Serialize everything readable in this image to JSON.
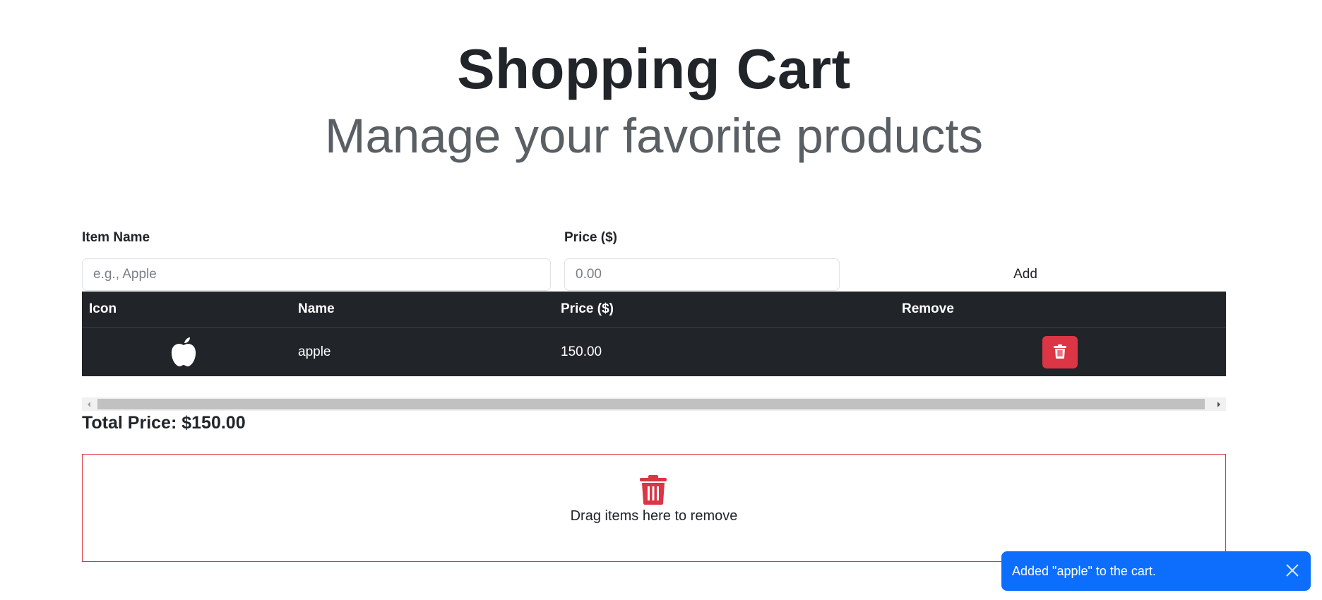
{
  "header": {
    "title": "Shopping Cart",
    "subtitle": "Manage your favorite products"
  },
  "form": {
    "item_name_label": "Item Name",
    "item_name_placeholder": "e.g., Apple",
    "item_name_value": "",
    "price_label": "Price ($)",
    "price_placeholder": "0.00",
    "price_value": "",
    "add_label": "Add"
  },
  "table": {
    "headers": {
      "icon": "Icon",
      "name": "Name",
      "price": "Price ($)",
      "remove": "Remove"
    },
    "rows": [
      {
        "icon": "apple-icon",
        "name": "apple",
        "price": "150.00",
        "remove_icon": "trash-icon"
      }
    ]
  },
  "total": {
    "text": "Total Price: $150.00"
  },
  "dropzone": {
    "icon": "trash-icon",
    "text": "Drag items here to remove"
  },
  "toast": {
    "message": "Added \"apple\" to the cart.",
    "close_icon": "close-icon"
  },
  "colors": {
    "table_bg": "#212529",
    "danger": "#dc3545",
    "toast_bg": "#0d6efd",
    "text": "#212529"
  }
}
